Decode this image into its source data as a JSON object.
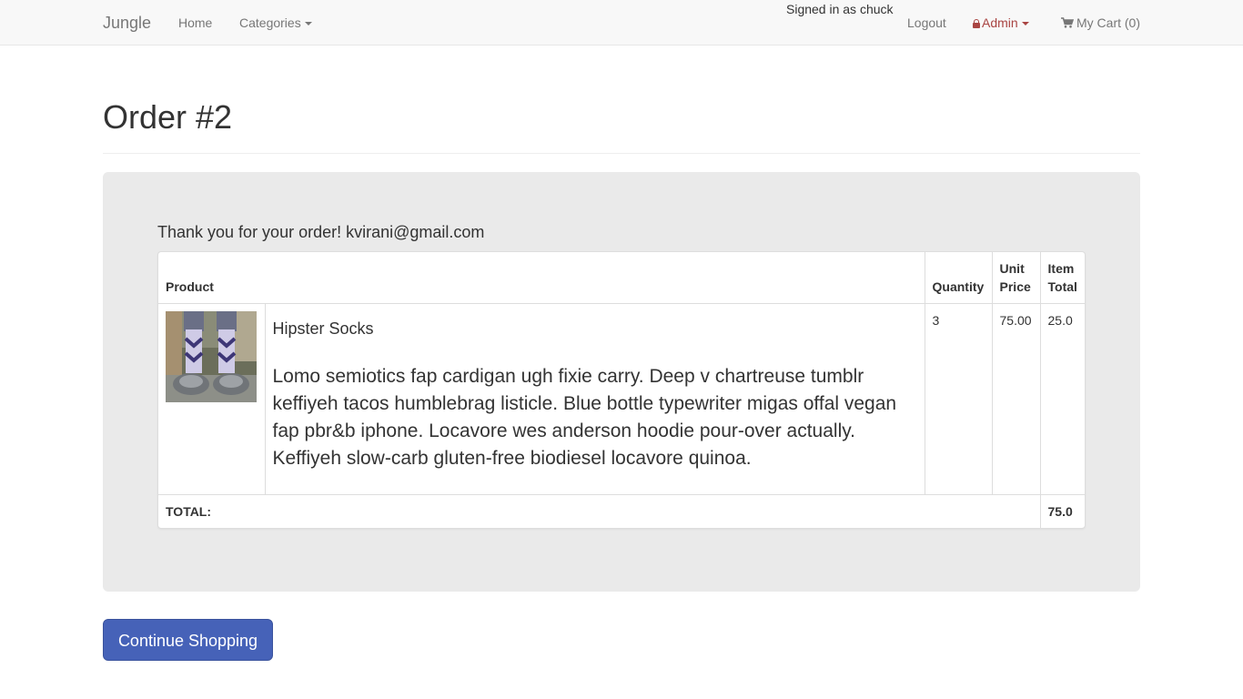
{
  "navbar": {
    "brand": "Jungle",
    "home": "Home",
    "categories": "Categories",
    "signed_in": "Signed in as chuck",
    "logout": "Logout",
    "admin": "Admin",
    "cart": "My Cart (0)"
  },
  "page": {
    "title": "Order #2",
    "thank_you": "Thank you for your order! kvirani@gmail.com",
    "continue_button": "Continue Shopping"
  },
  "table": {
    "headers": {
      "product": "Product",
      "quantity": "Quantity",
      "unit_price": "Unit Price",
      "item_total": "Item Total"
    },
    "rows": [
      {
        "name": "Hipster Socks",
        "description": "Lomo semiotics fap cardigan ugh fixie carry. Deep v chartreuse tumblr keffiyeh tacos humblebrag listicle. Blue bottle typewriter migas offal vegan fap pbr&b iphone. Locavore wes anderson hoodie pour-over actually. Keffiyeh slow-carb gluten-free biodiesel locavore quinoa.",
        "quantity": "3",
        "unit_price": "75.00",
        "item_total": "25.0",
        "image_icon": "hipster-socks-photo"
      }
    ],
    "total_label": "TOTAL:",
    "total_value": "75.0"
  },
  "colors": {
    "navbar_bg": "#f8f8f8",
    "admin_red": "#a94442",
    "jumbotron_bg": "#eaeaea",
    "button_blue": "#4662b8"
  }
}
